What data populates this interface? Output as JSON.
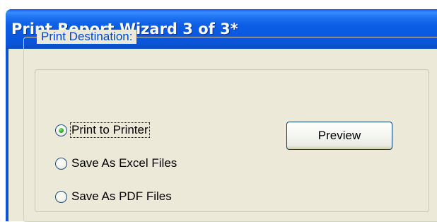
{
  "window": {
    "title": "Print Report Wizard 3 of 3*"
  },
  "print_destination": {
    "legend": "Print Destination:",
    "options": [
      {
        "label": "Print to Printer",
        "checked": true
      },
      {
        "label": "Save As Excel Files",
        "checked": false
      },
      {
        "label": "Save As PDF Files",
        "checked": false
      }
    ]
  },
  "buttons": {
    "preview_label": "Preview"
  },
  "colors": {
    "titlebar": "#0a58df",
    "client_background": "#ece9d8",
    "group_legend": "#0046d5",
    "radio_checked_dot": "#21a121"
  }
}
